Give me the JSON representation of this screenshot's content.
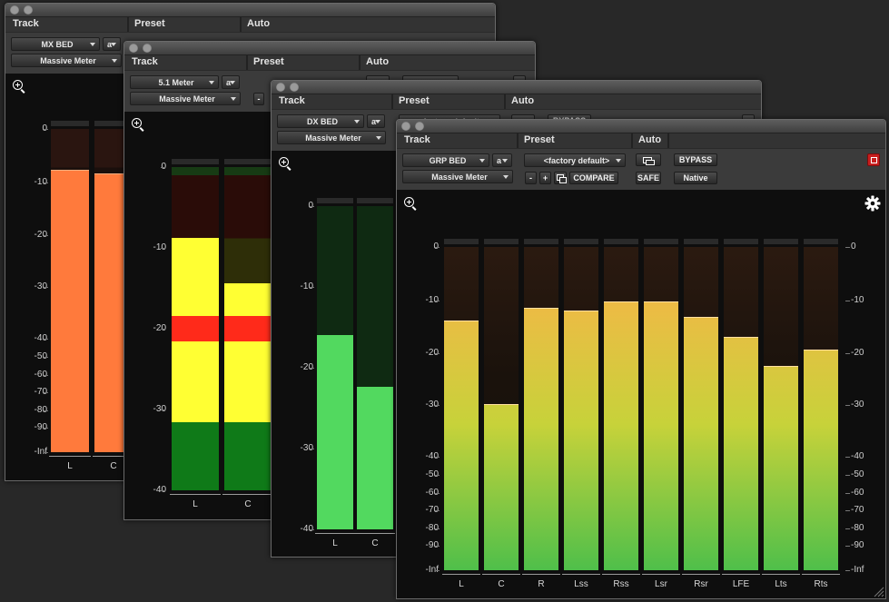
{
  "colors": {
    "orange_meter": "#ff7a3c",
    "yellow_meter": "#ffff33",
    "red_meter": "#ff2a1a",
    "green_meter": "#52d95f",
    "gradient_top": "#ffb04a",
    "gradient_bottom": "#4fbf4a",
    "bypass_red": "#d32020"
  },
  "windows": [
    {
      "id": "mx",
      "header": {
        "track_label": "Track",
        "preset_label": "Preset",
        "auto_label": "Auto"
      },
      "track": "MX BED",
      "track_letter": "a",
      "plugin": "Massive Meter",
      "scale": [
        "0",
        "-10",
        "-20",
        "-30",
        "-40",
        "-50",
        "-60",
        "-70",
        "-80",
        "-90",
        "-Inf"
      ],
      "channels": [
        {
          "name": "L",
          "level_fraction": 0.87
        },
        {
          "name": "C",
          "level_fraction": 0.86
        }
      ]
    },
    {
      "id": "51",
      "header": {
        "track_label": "Track",
        "preset_label": "Preset",
        "auto_label": "Auto"
      },
      "track": "5.1 Meter",
      "track_letter": "a",
      "plugin": "Massive Meter",
      "compare_minus": "-",
      "scale": [
        "0",
        "-10",
        "-20",
        "-30",
        "-40"
      ],
      "channels": [
        {
          "name": "L",
          "level_fraction": 0.78
        },
        {
          "name": "C",
          "level_fraction": 0.64
        }
      ]
    },
    {
      "id": "dx",
      "header": {
        "track_label": "Track",
        "preset_label": "Preset",
        "auto_label": "Auto"
      },
      "track": "DX BED",
      "track_letter": "a",
      "plugin": "Massive Meter",
      "preset_partial": "<factory default>",
      "bypass_partial": "BYPASS",
      "scale": [
        "0",
        "-10",
        "-20",
        "-30",
        "-40"
      ],
      "channels": [
        {
          "name": "L",
          "level_fraction": 0.6
        },
        {
          "name": "C",
          "level_fraction": 0.44
        }
      ]
    },
    {
      "id": "grp",
      "header": {
        "track_label": "Track",
        "preset_label": "Preset",
        "auto_label": "Auto"
      },
      "track": "GRP BED",
      "track_letter": "a",
      "plugin": "Massive Meter",
      "preset": "<factory default>",
      "minus": "-",
      "plus": "+",
      "compare": "COMPARE",
      "safe": "SAFE",
      "bypass": "BYPASS",
      "native": "Native",
      "scale": [
        "0",
        "-10",
        "-20",
        "-30",
        "-40",
        "-50",
        "-60",
        "-70",
        "-80",
        "-90",
        "-Inf"
      ],
      "channels": [
        {
          "name": "L",
          "level_fraction": 0.77
        },
        {
          "name": "C",
          "level_fraction": 0.51
        },
        {
          "name": "R",
          "level_fraction": 0.81
        },
        {
          "name": "Lss",
          "level_fraction": 0.8
        },
        {
          "name": "Rss",
          "level_fraction": 0.83
        },
        {
          "name": "Lsr",
          "level_fraction": 0.83
        },
        {
          "name": "Rsr",
          "level_fraction": 0.78
        },
        {
          "name": "LFE",
          "level_fraction": 0.72
        },
        {
          "name": "Lts",
          "level_fraction": 0.63
        },
        {
          "name": "Rts",
          "level_fraction": 0.68
        }
      ]
    }
  ]
}
